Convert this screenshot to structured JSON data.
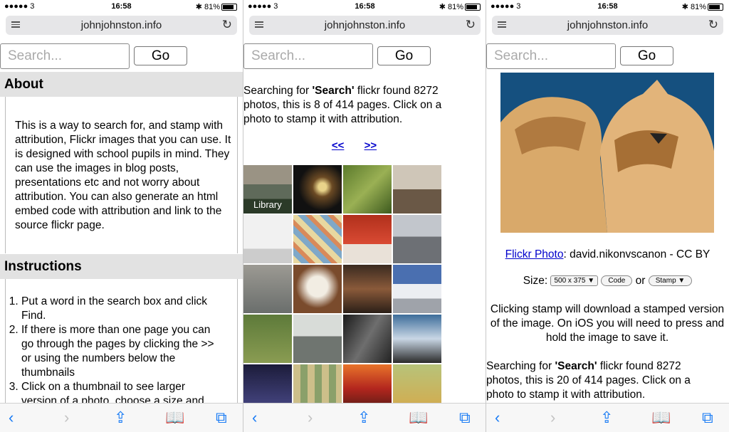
{
  "status": {
    "signal": "●●●●● 3",
    "time": "16:58",
    "battery": "81%"
  },
  "browser": {
    "domain": "johnjohnston.info"
  },
  "search": {
    "placeholder": "Search...",
    "go_label": "Go"
  },
  "about": {
    "heading": "About",
    "text": "This is a way to search for, and stamp with attribution, Flickr images that you can use. It is designed with school pupils in mind. They can use the images in blog posts, presentations etc and not worry about attribution. You can also generate an html embed code with attribution and link to the source flickr page."
  },
  "instructions": {
    "heading": "Instructions",
    "items": [
      "Put a word in the search box and click Find.",
      "If there is more than one page you can go through the pages by clicking the >> or using the numbers below the thumbnails",
      "Click on a thumbnail to see larger version of a photo, choose a size and"
    ]
  },
  "results_page": {
    "prefix": "Searching for ",
    "term": "'Search'",
    "suffix": " flickr found 8272 photos, this is 8 of 414 pages. Click on a photo to stamp it with attribution.",
    "prev": "<<",
    "next": ">>"
  },
  "photo_page": {
    "link_text": "Flickr Photo",
    "credit": ": david.nikonvscanon - CC BY",
    "size_label": "Size:",
    "size_value": "500 x 375",
    "code_button": "Code",
    "or_text": "or",
    "stamp_button": "Stamp ▼",
    "instructions_text": "Clicking stamp will download a stamped version of the image. On iOS you will need to press and hold the image to save it.",
    "search_prefix": "Searching for ",
    "search_term": "'Search'",
    "search_suffix": " flickr found 8272 photos, this is 20 of 414 pages. Click on a photo to stamp it with attribution."
  },
  "thumbnail_labels": {
    "library": "Library"
  },
  "colors": {
    "link": "#0000cc",
    "toolbar_icon": "#1a7cf5",
    "section_bg": "#e2e2e2"
  },
  "icons": [
    "menu-icon",
    "reload-icon",
    "back-icon",
    "forward-icon",
    "share-icon",
    "bookmarks-icon",
    "tabs-icon"
  ]
}
